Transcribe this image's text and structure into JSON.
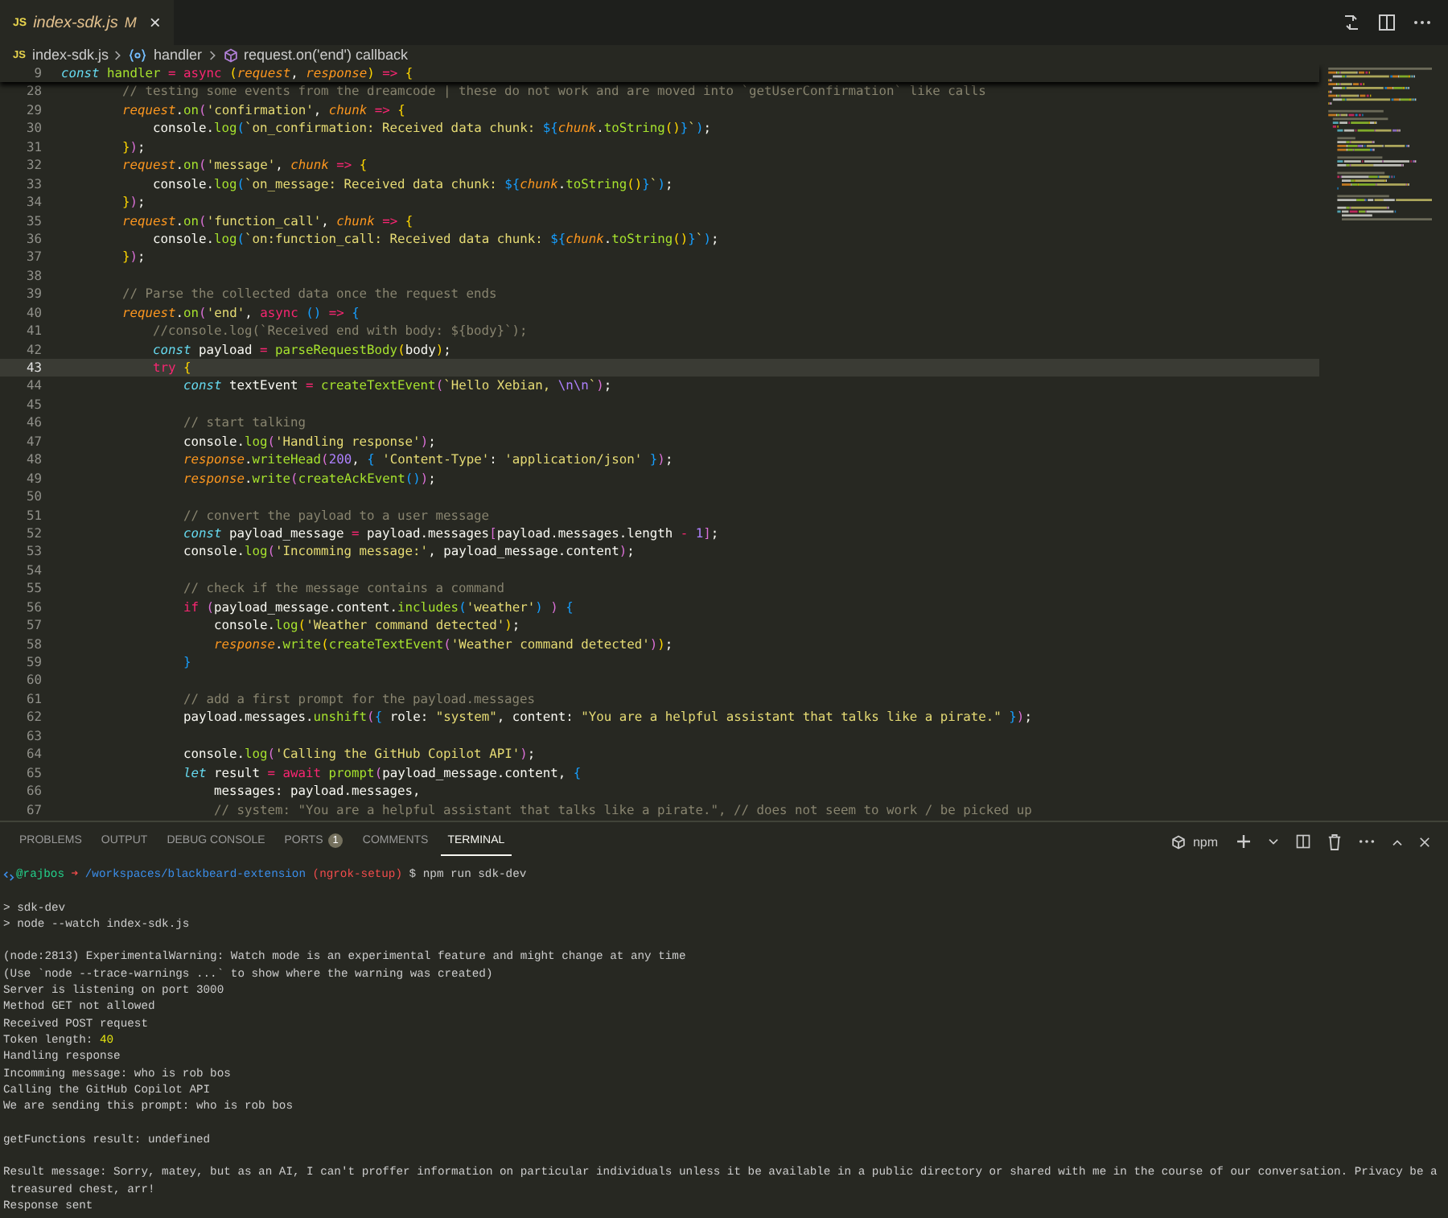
{
  "editor_tabs": [
    {
      "file_icon": "JS",
      "label": "index-sdk.js",
      "badge": "M",
      "close": "×",
      "selected": true
    }
  ],
  "breadcrumb": [
    {
      "kind": "file",
      "icon_text": "JS",
      "text": "index-sdk.js"
    },
    {
      "kind": "variable",
      "text": "handler"
    },
    {
      "kind": "method",
      "text": "request.on('end') callback"
    }
  ],
  "editor": {
    "sticky_line": {
      "number": "9",
      "tokens": [
        {
          "text": "const",
          "kind": "st"
        },
        {
          "text": " handler",
          "kind": "fn"
        },
        {
          "text": " = ",
          "kind": "kw"
        },
        {
          "text": "async",
          "kind": "kw"
        },
        {
          "text": " (",
          "kind": "b1"
        },
        {
          "text": "request",
          "kind": "v"
        },
        {
          "text": ", ",
          "kind": "p"
        },
        {
          "text": "response",
          "kind": "v"
        },
        {
          "text": ")",
          "kind": "b1"
        },
        {
          "text": " => ",
          "kind": "kw"
        },
        {
          "text": "{",
          "kind": "b1"
        }
      ]
    },
    "lines": [
      {
        "number": "28",
        "current": false,
        "tokens": [
          {
            "text": "        // testing some events from the dreamcode | these do not work and are moved into `getUserConfirmation` like calls",
            "kind": "c"
          }
        ]
      },
      {
        "number": "29",
        "current": false,
        "tokens": [
          {
            "text": "        request",
            "kind": "v"
          },
          {
            "text": ".",
            "kind": "p"
          },
          {
            "text": "on",
            "kind": "fn"
          },
          {
            "text": "(",
            "kind": "b2"
          },
          {
            "text": "'confirmation'",
            "kind": "s"
          },
          {
            "text": ", ",
            "kind": "p"
          },
          {
            "text": "chunk",
            "kind": "v"
          },
          {
            "text": " => ",
            "kind": "kw"
          },
          {
            "text": "{",
            "kind": "b1"
          }
        ]
      },
      {
        "number": "30",
        "current": false,
        "tokens": [
          {
            "text": "            console.",
            "kind": "p"
          },
          {
            "text": "log",
            "kind": "fn"
          },
          {
            "text": "(",
            "kind": "b3"
          },
          {
            "text": "`on_confirmation: Received data chunk: ",
            "kind": "s"
          },
          {
            "text": "${",
            "kind": "b3"
          },
          {
            "text": "chunk",
            "kind": "v"
          },
          {
            "text": ".",
            "kind": "p"
          },
          {
            "text": "toString",
            "kind": "fn"
          },
          {
            "text": "()",
            "kind": "b1"
          },
          {
            "text": "}",
            "kind": "b3"
          },
          {
            "text": "`",
            "kind": "s"
          },
          {
            "text": ")",
            "kind": "b3"
          },
          {
            "text": ";",
            "kind": "p"
          }
        ]
      },
      {
        "number": "31",
        "current": false,
        "tokens": [
          {
            "text": "        }",
            "kind": "b1"
          },
          {
            "text": ")",
            "kind": "b2"
          },
          {
            "text": ";",
            "kind": "p"
          }
        ]
      },
      {
        "number": "32",
        "current": false,
        "tokens": [
          {
            "text": "        request",
            "kind": "v"
          },
          {
            "text": ".",
            "kind": "p"
          },
          {
            "text": "on",
            "kind": "fn"
          },
          {
            "text": "(",
            "kind": "b2"
          },
          {
            "text": "'message'",
            "kind": "s"
          },
          {
            "text": ", ",
            "kind": "p"
          },
          {
            "text": "chunk",
            "kind": "v"
          },
          {
            "text": " => ",
            "kind": "kw"
          },
          {
            "text": "{",
            "kind": "b1"
          }
        ]
      },
      {
        "number": "33",
        "current": false,
        "tokens": [
          {
            "text": "            console.",
            "kind": "p"
          },
          {
            "text": "log",
            "kind": "fn"
          },
          {
            "text": "(",
            "kind": "b3"
          },
          {
            "text": "`on_message: Received data chunk: ",
            "kind": "s"
          },
          {
            "text": "${",
            "kind": "b3"
          },
          {
            "text": "chunk",
            "kind": "v"
          },
          {
            "text": ".",
            "kind": "p"
          },
          {
            "text": "toString",
            "kind": "fn"
          },
          {
            "text": "()",
            "kind": "b1"
          },
          {
            "text": "}",
            "kind": "b3"
          },
          {
            "text": "`",
            "kind": "s"
          },
          {
            "text": ")",
            "kind": "b3"
          },
          {
            "text": ";",
            "kind": "p"
          }
        ]
      },
      {
        "number": "34",
        "current": false,
        "tokens": [
          {
            "text": "        }",
            "kind": "b1"
          },
          {
            "text": ")",
            "kind": "b2"
          },
          {
            "text": ";",
            "kind": "p"
          }
        ]
      },
      {
        "number": "35",
        "current": false,
        "tokens": [
          {
            "text": "        request",
            "kind": "v"
          },
          {
            "text": ".",
            "kind": "p"
          },
          {
            "text": "on",
            "kind": "fn"
          },
          {
            "text": "(",
            "kind": "b2"
          },
          {
            "text": "'function_call'",
            "kind": "s"
          },
          {
            "text": ", ",
            "kind": "p"
          },
          {
            "text": "chunk",
            "kind": "v"
          },
          {
            "text": " => ",
            "kind": "kw"
          },
          {
            "text": "{",
            "kind": "b1"
          }
        ]
      },
      {
        "number": "36",
        "current": false,
        "tokens": [
          {
            "text": "            console.",
            "kind": "p"
          },
          {
            "text": "log",
            "kind": "fn"
          },
          {
            "text": "(",
            "kind": "b3"
          },
          {
            "text": "`on:function_call: Received data chunk: ",
            "kind": "s"
          },
          {
            "text": "${",
            "kind": "b3"
          },
          {
            "text": "chunk",
            "kind": "v"
          },
          {
            "text": ".",
            "kind": "p"
          },
          {
            "text": "toString",
            "kind": "fn"
          },
          {
            "text": "()",
            "kind": "b1"
          },
          {
            "text": "}",
            "kind": "b3"
          },
          {
            "text": "`",
            "kind": "s"
          },
          {
            "text": ")",
            "kind": "b3"
          },
          {
            "text": ";",
            "kind": "p"
          }
        ]
      },
      {
        "number": "37",
        "current": false,
        "tokens": [
          {
            "text": "        }",
            "kind": "b1"
          },
          {
            "text": ")",
            "kind": "b2"
          },
          {
            "text": ";",
            "kind": "p"
          }
        ]
      },
      {
        "number": "38",
        "current": false
      },
      {
        "number": "39",
        "current": false,
        "tokens": [
          {
            "text": "        // Parse the collected data once the request ends",
            "kind": "c"
          }
        ]
      },
      {
        "number": "40",
        "current": false,
        "tokens": [
          {
            "text": "        request",
            "kind": "v"
          },
          {
            "text": ".",
            "kind": "p"
          },
          {
            "text": "on",
            "kind": "fn"
          },
          {
            "text": "(",
            "kind": "b2"
          },
          {
            "text": "'end'",
            "kind": "s"
          },
          {
            "text": ", ",
            "kind": "p"
          },
          {
            "text": "async",
            "kind": "kw"
          },
          {
            "text": " ()",
            "kind": "b3"
          },
          {
            "text": " => ",
            "kind": "kw"
          },
          {
            "text": "{",
            "kind": "b3"
          }
        ]
      },
      {
        "number": "41",
        "current": false,
        "tokens": [
          {
            "text": "            //console.log(`Received end with body: ${body}`);",
            "kind": "c"
          }
        ]
      },
      {
        "number": "42",
        "current": false,
        "tokens": [
          {
            "text": "            const",
            "kind": "st"
          },
          {
            "text": " payload ",
            "kind": "p"
          },
          {
            "text": "= ",
            "kind": "kw"
          },
          {
            "text": "parseRequestBody",
            "kind": "fn"
          },
          {
            "text": "(",
            "kind": "b1"
          },
          {
            "text": "body",
            "kind": "p"
          },
          {
            "text": ")",
            "kind": "b1"
          },
          {
            "text": ";",
            "kind": "p"
          }
        ]
      },
      {
        "number": "43",
        "current": true,
        "tokens": [
          {
            "text": "            try",
            "kind": "kw"
          },
          {
            "text": " {",
            "kind": "b1"
          }
        ]
      },
      {
        "number": "44",
        "current": false,
        "tokens": [
          {
            "text": "                const",
            "kind": "st"
          },
          {
            "text": " textEvent ",
            "kind": "p"
          },
          {
            "text": "= ",
            "kind": "kw"
          },
          {
            "text": "createTextEvent",
            "kind": "fn"
          },
          {
            "text": "(",
            "kind": "b2"
          },
          {
            "text": "`Hello Xebian, ",
            "kind": "s"
          },
          {
            "text": "\\n\\n",
            "kind": "n"
          },
          {
            "text": "`",
            "kind": "s"
          },
          {
            "text": ")",
            "kind": "b2"
          },
          {
            "text": ";",
            "kind": "p"
          }
        ]
      },
      {
        "number": "45",
        "current": false
      },
      {
        "number": "46",
        "current": false,
        "tokens": [
          {
            "text": "                // start talking",
            "kind": "c"
          }
        ]
      },
      {
        "number": "47",
        "current": false,
        "tokens": [
          {
            "text": "                console.",
            "kind": "p"
          },
          {
            "text": "log",
            "kind": "fn"
          },
          {
            "text": "(",
            "kind": "b2"
          },
          {
            "text": "'Handling response'",
            "kind": "s"
          },
          {
            "text": ")",
            "kind": "b2"
          },
          {
            "text": ";",
            "kind": "p"
          }
        ]
      },
      {
        "number": "48",
        "current": false,
        "tokens": [
          {
            "text": "                response",
            "kind": "v"
          },
          {
            "text": ".",
            "kind": "p"
          },
          {
            "text": "writeHead",
            "kind": "fn"
          },
          {
            "text": "(",
            "kind": "b2"
          },
          {
            "text": "200",
            "kind": "n"
          },
          {
            "text": ", ",
            "kind": "p"
          },
          {
            "text": "{ ",
            "kind": "b3"
          },
          {
            "text": "'Content-Type'",
            "kind": "s"
          },
          {
            "text": ": ",
            "kind": "p"
          },
          {
            "text": "'application/json'",
            "kind": "s"
          },
          {
            "text": " }",
            "kind": "b3"
          },
          {
            "text": ")",
            "kind": "b2"
          },
          {
            "text": ";",
            "kind": "p"
          }
        ]
      },
      {
        "number": "49",
        "current": false,
        "tokens": [
          {
            "text": "                response",
            "kind": "v"
          },
          {
            "text": ".",
            "kind": "p"
          },
          {
            "text": "write",
            "kind": "fn"
          },
          {
            "text": "(",
            "kind": "b2"
          },
          {
            "text": "createAckEvent",
            "kind": "fn"
          },
          {
            "text": "()",
            "kind": "b3"
          },
          {
            "text": ")",
            "kind": "b2"
          },
          {
            "text": ";",
            "kind": "p"
          }
        ]
      },
      {
        "number": "50",
        "current": false
      },
      {
        "number": "51",
        "current": false,
        "tokens": [
          {
            "text": "                // convert the payload to a user message",
            "kind": "c"
          }
        ]
      },
      {
        "number": "52",
        "current": false,
        "tokens": [
          {
            "text": "                const",
            "kind": "st"
          },
          {
            "text": " payload_message ",
            "kind": "p"
          },
          {
            "text": "=",
            "kind": "kw"
          },
          {
            "text": " payload.messages",
            "kind": "p"
          },
          {
            "text": "[",
            "kind": "b2"
          },
          {
            "text": "payload.messages.length ",
            "kind": "p"
          },
          {
            "text": "- ",
            "kind": "kw"
          },
          {
            "text": "1",
            "kind": "n"
          },
          {
            "text": "]",
            "kind": "b2"
          },
          {
            "text": ";",
            "kind": "p"
          }
        ]
      },
      {
        "number": "53",
        "current": false,
        "tokens": [
          {
            "text": "                console.",
            "kind": "p"
          },
          {
            "text": "log",
            "kind": "fn"
          },
          {
            "text": "(",
            "kind": "b2"
          },
          {
            "text": "'Incomming message:'",
            "kind": "s"
          },
          {
            "text": ", payload_message.content",
            "kind": "p"
          },
          {
            "text": ")",
            "kind": "b2"
          },
          {
            "text": ";",
            "kind": "p"
          }
        ]
      },
      {
        "number": "54",
        "current": false
      },
      {
        "number": "55",
        "current": false,
        "tokens": [
          {
            "text": "                // check if the message contains a command",
            "kind": "c"
          }
        ]
      },
      {
        "number": "56",
        "current": false,
        "tokens": [
          {
            "text": "                if",
            "kind": "kw"
          },
          {
            "text": " (",
            "kind": "b2"
          },
          {
            "text": "payload_message.content.",
            "kind": "p"
          },
          {
            "text": "includes",
            "kind": "fn"
          },
          {
            "text": "(",
            "kind": "b3"
          },
          {
            "text": "'weather'",
            "kind": "s"
          },
          {
            "text": ")",
            "kind": "b3"
          },
          {
            "text": " )",
            "kind": "b2"
          },
          {
            "text": " {",
            "kind": "b3"
          }
        ]
      },
      {
        "number": "57",
        "current": false,
        "tokens": [
          {
            "text": "                    console.",
            "kind": "p"
          },
          {
            "text": "log",
            "kind": "fn"
          },
          {
            "text": "(",
            "kind": "b1"
          },
          {
            "text": "'Weather command detected'",
            "kind": "s"
          },
          {
            "text": ")",
            "kind": "b1"
          },
          {
            "text": ";",
            "kind": "p"
          }
        ]
      },
      {
        "number": "58",
        "current": false,
        "tokens": [
          {
            "text": "                    response",
            "kind": "v"
          },
          {
            "text": ".",
            "kind": "p"
          },
          {
            "text": "write",
            "kind": "fn"
          },
          {
            "text": "(",
            "kind": "b1"
          },
          {
            "text": "createTextEvent",
            "kind": "fn"
          },
          {
            "text": "(",
            "kind": "b2"
          },
          {
            "text": "'Weather command detected'",
            "kind": "s"
          },
          {
            "text": ")",
            "kind": "b2"
          },
          {
            "text": ")",
            "kind": "b1"
          },
          {
            "text": ";",
            "kind": "p"
          }
        ]
      },
      {
        "number": "59",
        "current": false,
        "tokens": [
          {
            "text": "                }",
            "kind": "b3"
          }
        ]
      },
      {
        "number": "60",
        "current": false
      },
      {
        "number": "61",
        "current": false,
        "tokens": [
          {
            "text": "                // add a first prompt for the payload.messages",
            "kind": "c"
          }
        ]
      },
      {
        "number": "62",
        "current": false,
        "tokens": [
          {
            "text": "                payload.messages.",
            "kind": "p"
          },
          {
            "text": "unshift",
            "kind": "fn"
          },
          {
            "text": "(",
            "kind": "b2"
          },
          {
            "text": "{",
            "kind": "b3"
          },
          {
            "text": " role: ",
            "kind": "p"
          },
          {
            "text": "\"system\"",
            "kind": "s"
          },
          {
            "text": ", content: ",
            "kind": "p"
          },
          {
            "text": "\"You are a helpful assistant that talks like a pirate.\"",
            "kind": "s"
          },
          {
            "text": " }",
            "kind": "b3"
          },
          {
            "text": ")",
            "kind": "b2"
          },
          {
            "text": ";",
            "kind": "p"
          }
        ]
      },
      {
        "number": "63",
        "current": false
      },
      {
        "number": "64",
        "current": false,
        "tokens": [
          {
            "text": "                console.",
            "kind": "p"
          },
          {
            "text": "log",
            "kind": "fn"
          },
          {
            "text": "(",
            "kind": "b2"
          },
          {
            "text": "'Calling the GitHub Copilot API'",
            "kind": "s"
          },
          {
            "text": ")",
            "kind": "b2"
          },
          {
            "text": ";",
            "kind": "p"
          }
        ]
      },
      {
        "number": "65",
        "current": false,
        "tokens": [
          {
            "text": "                let",
            "kind": "st"
          },
          {
            "text": " result ",
            "kind": "p"
          },
          {
            "text": "= await ",
            "kind": "kw"
          },
          {
            "text": "prompt",
            "kind": "fn"
          },
          {
            "text": "(",
            "kind": "b2"
          },
          {
            "text": "payload_message.content, ",
            "kind": "p"
          },
          {
            "text": "{",
            "kind": "b3"
          }
        ]
      },
      {
        "number": "66",
        "current": false,
        "tokens": [
          {
            "text": "                    messages: payload.messages,",
            "kind": "p"
          }
        ]
      },
      {
        "number": "67",
        "current": false,
        "tokens": [
          {
            "text": "                    // system: \"You are a helpful assistant that talks like a pirate.\", // does not seem to work / be picked up",
            "kind": "c"
          }
        ]
      }
    ]
  },
  "panel": {
    "tabs": [
      {
        "label": "PROBLEMS",
        "selected": false
      },
      {
        "label": "OUTPUT",
        "selected": false
      },
      {
        "label": "DEBUG CONSOLE",
        "selected": false
      },
      {
        "label": "PORTS",
        "badge": "1",
        "selected": false
      },
      {
        "label": "COMMENTS",
        "selected": false
      },
      {
        "label": "TERMINAL",
        "selected": true
      }
    ],
    "terminal_profile": "npm",
    "terminal_lines": [
      {
        "tokens": [
          {
            "text": "@rajbos ",
            "kind": "user"
          },
          {
            "text": "➜ ",
            "kind": "arrow"
          },
          {
            "text": "/workspaces/blackbeard-extension ",
            "kind": "path"
          },
          {
            "text": "(ngrok-setup)",
            "kind": "branch"
          },
          {
            "text": " $ npm run sdk-dev",
            "kind": "p"
          }
        ]
      },
      {
        "gap_before": true,
        "tokens": [
          {
            "text": "> sdk-dev",
            "kind": "p"
          }
        ]
      },
      {
        "tokens": [
          {
            "text": "> node --watch index-sdk.js",
            "kind": "p"
          }
        ]
      },
      {
        "gap_before": true,
        "tokens": [
          {
            "text": "(node:2813) ExperimentalWarning: Watch mode is an experimental feature and might change at any time",
            "kind": "p"
          }
        ]
      },
      {
        "tokens": [
          {
            "text": "(Use `node --trace-warnings ...` to show where the warning was created)",
            "kind": "p"
          }
        ]
      },
      {
        "tokens": [
          {
            "text": "Server is listening on port 3000",
            "kind": "p"
          }
        ]
      },
      {
        "tokens": [
          {
            "text": "Method GET not allowed",
            "kind": "p"
          }
        ]
      },
      {
        "tokens": [
          {
            "text": "Received POST request",
            "kind": "p"
          }
        ]
      },
      {
        "tokens": [
          {
            "text": "Token length: ",
            "kind": "p"
          },
          {
            "text": "40",
            "kind": "num"
          }
        ]
      },
      {
        "tokens": [
          {
            "text": "Handling response",
            "kind": "p"
          }
        ]
      },
      {
        "tokens": [
          {
            "text": "Incomming message: who is rob bos",
            "kind": "p"
          }
        ]
      },
      {
        "tokens": [
          {
            "text": "Calling the GitHub Copilot API",
            "kind": "p"
          }
        ]
      },
      {
        "tokens": [
          {
            "text": "We are sending this prompt: who is rob bos",
            "kind": "p"
          }
        ]
      },
      {
        "gap_before": true,
        "tokens": [
          {
            "text": "getFunctions result: undefined",
            "kind": "p"
          }
        ]
      },
      {
        "gap_before": true,
        "tokens": [
          {
            "text": "Result message: Sorry, matey, but as an AI, I can't proffer information on particular individuals unless it be available in a public directory or shared with me in the course of our conversation. Privacy be a",
            "kind": "p"
          }
        ]
      },
      {
        "tokens": [
          {
            "text": " treasured chest, arr!",
            "kind": "p"
          }
        ]
      },
      {
        "tokens": [
          {
            "text": "Response sent",
            "kind": "p"
          }
        ]
      }
    ]
  }
}
